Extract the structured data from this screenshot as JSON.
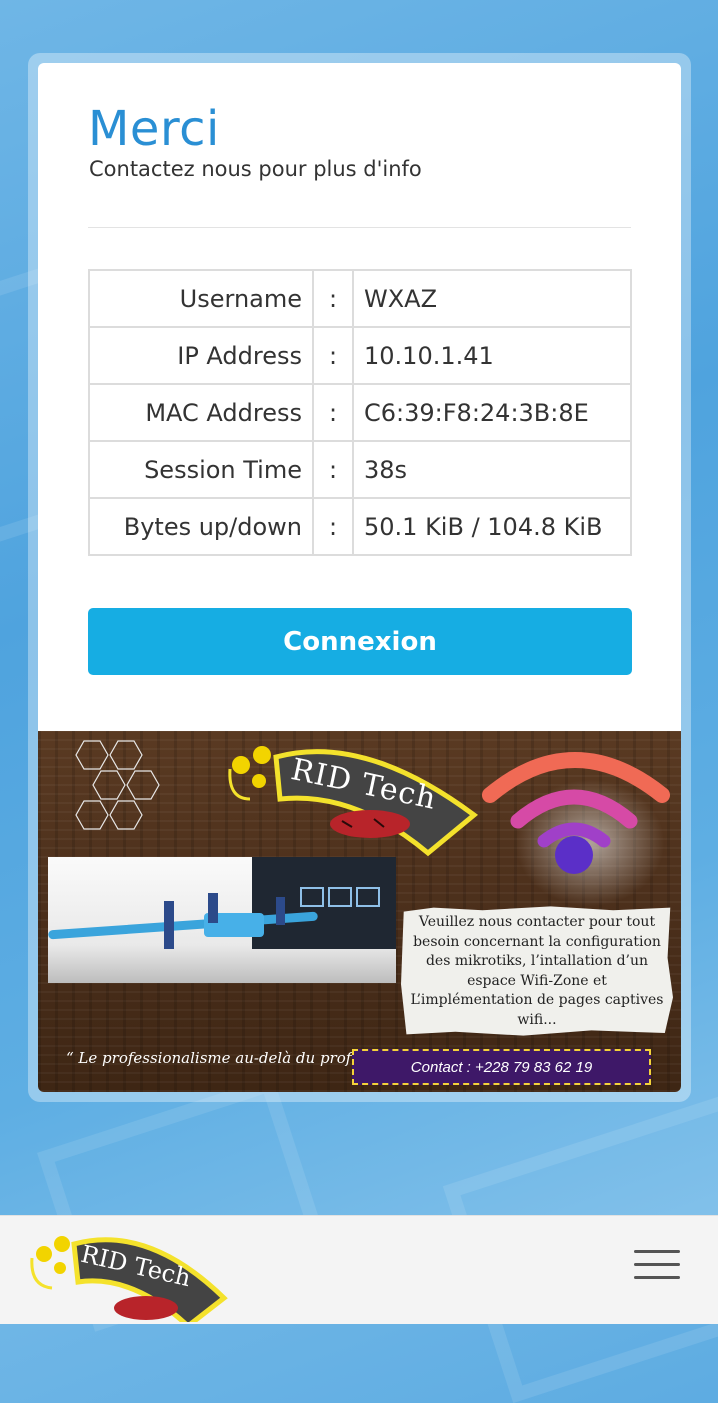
{
  "header": {
    "title": "Merci",
    "subtitle": "Contactez nous pour plus d'info"
  },
  "status_table": {
    "separator": ":",
    "rows": [
      {
        "label": "Username",
        "value": "WXAZ"
      },
      {
        "label": "IP Address",
        "value": "10.10.1.41"
      },
      {
        "label": "MAC Address",
        "value": "C6:39:F8:24:3B:8E"
      },
      {
        "label": "Session Time",
        "value": "38s"
      },
      {
        "label": "Bytes up/down",
        "value": "50.1 KiB / 104.8 KiB"
      }
    ]
  },
  "actions": {
    "connect_label": "Connexion"
  },
  "banner": {
    "brand": "RID Tech",
    "notice_lines": [
      "Veuillez nous contacter pour tout",
      "besoin concernant la configuration",
      "des mikrotiks, l’intallation d’un",
      "espace Wifi-Zone et",
      "L’implémentation de pages captives",
      "wifi..."
    ],
    "slogan": "“ Le professionalisme au-delà du profit ”",
    "contact": "Contact : +228 79 83 62 19"
  },
  "footer": {
    "logo_text": "RID Tech",
    "menu_icon": "hamburger-menu-icon"
  },
  "colors": {
    "title": "#2a8fd4",
    "button": "#16ade3",
    "banner_wood": "#4b2f1b",
    "contact_bg": "#3e1868",
    "logo_yellow": "#f4e22c"
  }
}
